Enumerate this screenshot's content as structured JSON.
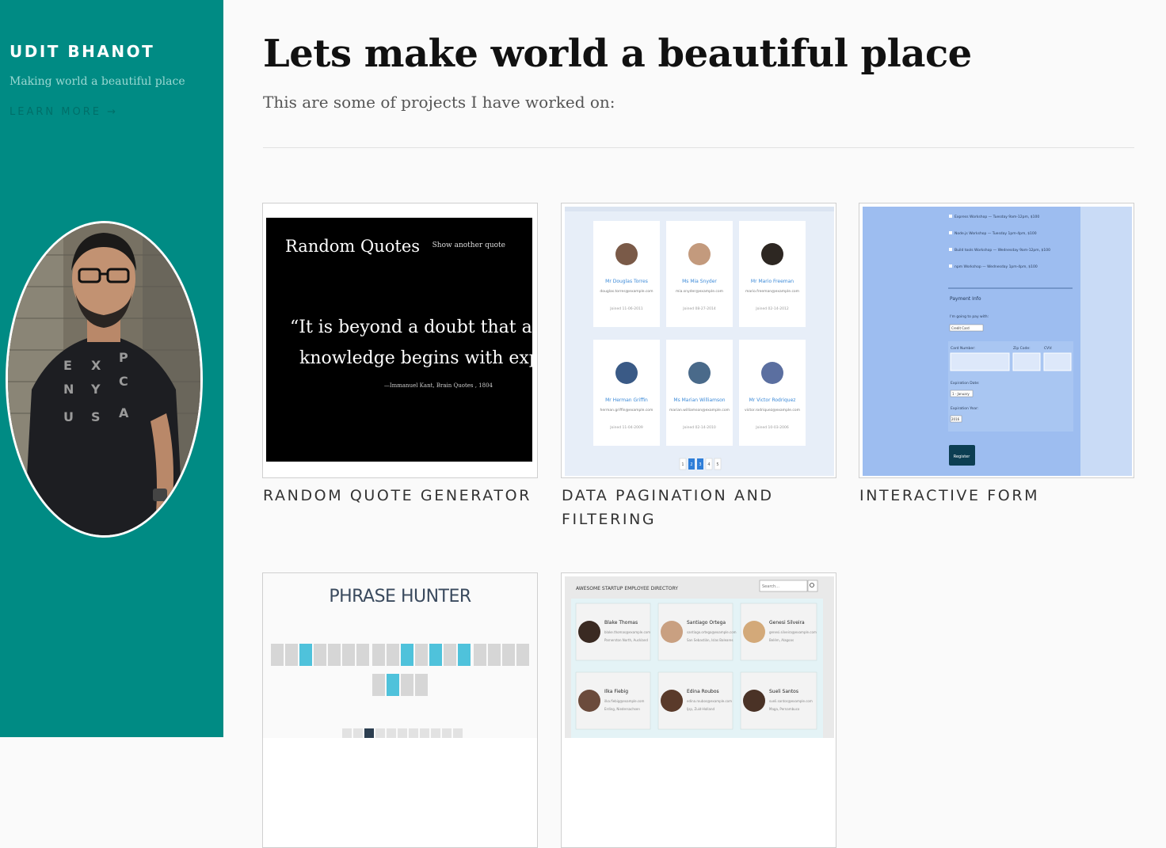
{
  "sidebar": {
    "brand": "UDIT BHANOT",
    "tagline": "Making world a beautiful place",
    "learn_more": "LEARN MORE →",
    "background": "#008b84"
  },
  "main": {
    "title": "Lets make world a beautiful place",
    "subtitle": "This are some of projects I have worked on:"
  },
  "projects": [
    {
      "label": "RANDOM QUOTE GENERATOR",
      "thumb": {
        "heading": "Random Quotes",
        "button": "Show another quote",
        "quote_line1": "“It is beyond a doubt that all our",
        "quote_line2": "knowledge begins with experience”",
        "source": "—Immanuel Kant, Brain Quotes , 1804"
      }
    },
    {
      "label": "DATA PAGINATION AND FILTERING",
      "thumb": {
        "people": [
          {
            "name": "Mr Douglas Torres",
            "email": "douglas.torres@example.com",
            "joined": "Joined 11-06-2011"
          },
          {
            "name": "Ms Mia Snyder",
            "email": "mia.snyder@example.com",
            "joined": "Joined 08-27-2014"
          },
          {
            "name": "Mr Mario Freeman",
            "email": "mario.freeman@example.com",
            "joined": "Joined 02-14-2012"
          },
          {
            "name": "Mr Herman Griffin",
            "email": "herman.griffin@example.com",
            "joined": "Joined 11-04-2009"
          },
          {
            "name": "Ms Marian Williamson",
            "email": "marian.williamson@example.com",
            "joined": "Joined 02-14-2010"
          },
          {
            "name": "Mr Victor Rodriquez",
            "email": "victor.rodriquez@example.com",
            "joined": "Joined 10-03-2006"
          }
        ],
        "pages": [
          "1",
          "2",
          "3",
          "4",
          "5"
        ]
      }
    },
    {
      "label": "INTERACTIVE FORM",
      "thumb": {
        "workshops": [
          "Express Workshop — Tuesday 9am-12pm, $100",
          "Node.js Workshop — Tuesday 1pm-4pm, $100",
          "Build tools Workshop — Wednesday 9am-12pm, $100",
          "npm Workshop — Wednesday 1pm-4pm, $100"
        ],
        "payment_heading": "Payment Info",
        "pay_with_label": "I'm going to pay with:",
        "pay_with_value": "Credit Card",
        "card_number_label": "Card Number:",
        "zip_label": "Zip Code:",
        "cvv_label": "CVV:",
        "exp_date_label": "Expiration Date:",
        "exp_date_value": "1 - January",
        "exp_year_label": "Expiration Year:",
        "exp_year_value": "2016",
        "register": "Register"
      }
    },
    {
      "label": "",
      "thumb": {
        "heading": "PHRASE HUNTER"
      }
    },
    {
      "label": "",
      "thumb": {
        "heading": "AWESOME STARTUP EMPLOYEE DIRECTORY",
        "search_placeholder": "Search...",
        "employees": [
          {
            "name": "Blake Thomas",
            "email": "blake.thomas@example.com",
            "location": "Parnerston North, Auckland"
          },
          {
            "name": "Santiago Ortega",
            "email": "santiago.ortega@example.com",
            "location": "San Sebastián, Islas Baleares"
          },
          {
            "name": "Genesi Silveira",
            "email": "genesi.silveira@example.com",
            "location": "Belém, Alagoas"
          },
          {
            "name": "Ilka Fiebig",
            "email": "ilka.fiebig@example.com",
            "location": "Erding, Niedersachsen"
          },
          {
            "name": "Edina Roubos",
            "email": "edina.roubos@example.com",
            "location": "Ijsp, Zuid-Holland"
          },
          {
            "name": "Sueli Santos",
            "email": "sueli.santos@example.com",
            "location": "Maga, Pernambuco"
          }
        ]
      }
    }
  ]
}
